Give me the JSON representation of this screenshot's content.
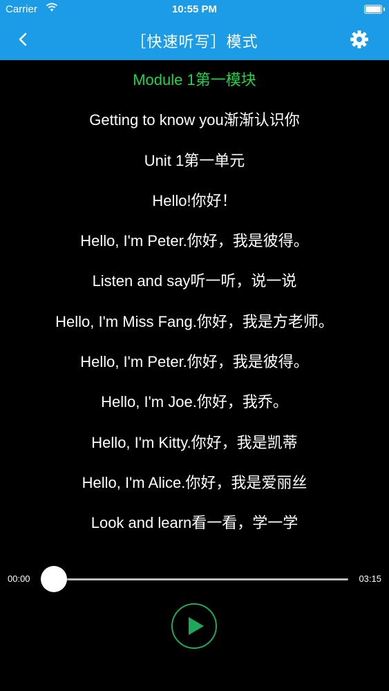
{
  "status_bar": {
    "carrier": "Carrier",
    "time": "10:55 PM",
    "battery_level": 1.0
  },
  "nav": {
    "title": "［快速听写］模式",
    "back_icon": "chevron-left-icon",
    "settings_icon": "gear-icon"
  },
  "lyrics": [
    {
      "text": "Module 1第一模块",
      "current": true
    },
    {
      "text": "Getting to know you渐渐认识你",
      "current": false
    },
    {
      "text": "Unit 1第一单元",
      "current": false
    },
    {
      "text": "Hello!你好！",
      "current": false
    },
    {
      "text": "Hello, I'm Peter.你好，我是彼得。",
      "current": false
    },
    {
      "text": "Listen and say听一听，说一说",
      "current": false
    },
    {
      "text": "Hello, I'm Miss Fang.你好，我是方老师。",
      "current": false
    },
    {
      "text": "Hello, I'm Peter.你好，我是彼得。",
      "current": false
    },
    {
      "text": "Hello, I'm Joe.你好，我乔。",
      "current": false
    },
    {
      "text": "Hello, I'm Kitty.你好，我是凯蒂",
      "current": false
    },
    {
      "text": "Hello, I'm Alice.你好，我是爱丽丝",
      "current": false
    },
    {
      "text": "Look and learn看一看，学一学",
      "current": false
    }
  ],
  "player": {
    "current_time": "00:00",
    "total_time": "03:15",
    "progress": 0.0,
    "play_icon": "play-icon"
  },
  "colors": {
    "header": "#1c9be6",
    "current_line": "#22d34a",
    "play_ring": "#1fa85a",
    "background": "#000000"
  }
}
